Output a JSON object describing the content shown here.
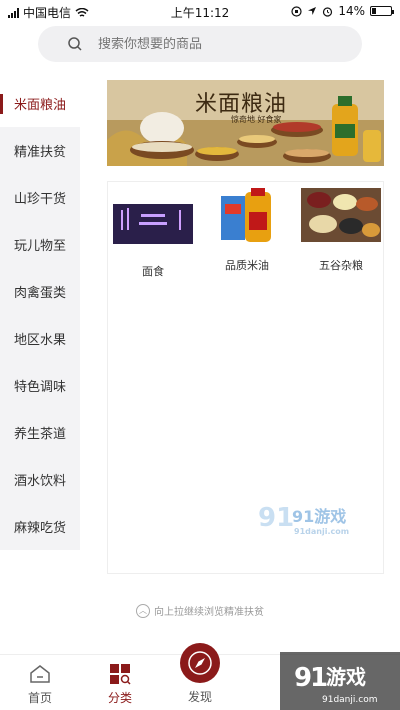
{
  "status_bar": {
    "carrier": "中国电信",
    "time": "上午11:12",
    "battery_percent": "14%"
  },
  "search": {
    "placeholder": "搜索你想要的商品"
  },
  "sidebar": {
    "items": [
      {
        "label": "米面粮油",
        "active": true
      },
      {
        "label": "精准扶贫"
      },
      {
        "label": "山珍干货"
      },
      {
        "label": "玩儿物至"
      },
      {
        "label": "肉禽蛋类"
      },
      {
        "label": "地区水果"
      },
      {
        "label": "特色调味"
      },
      {
        "label": "养生茶道"
      },
      {
        "label": "酒水饮料"
      },
      {
        "label": "麻辣吃货"
      }
    ]
  },
  "banner": {
    "title": "米面粮油",
    "subtitle": "惊奇地 好食家"
  },
  "products": [
    {
      "label": "面食"
    },
    {
      "label": "品质米油"
    },
    {
      "label": "五谷杂粮"
    }
  ],
  "pull_hint": "向上拉继续浏览精准扶贫",
  "tabbar": {
    "home": "首页",
    "category": "分类",
    "discover": "发现"
  },
  "watermarks": {
    "brand": "91游戏",
    "site": "91danji.com"
  },
  "colors": {
    "accent": "#8b1a1a"
  }
}
